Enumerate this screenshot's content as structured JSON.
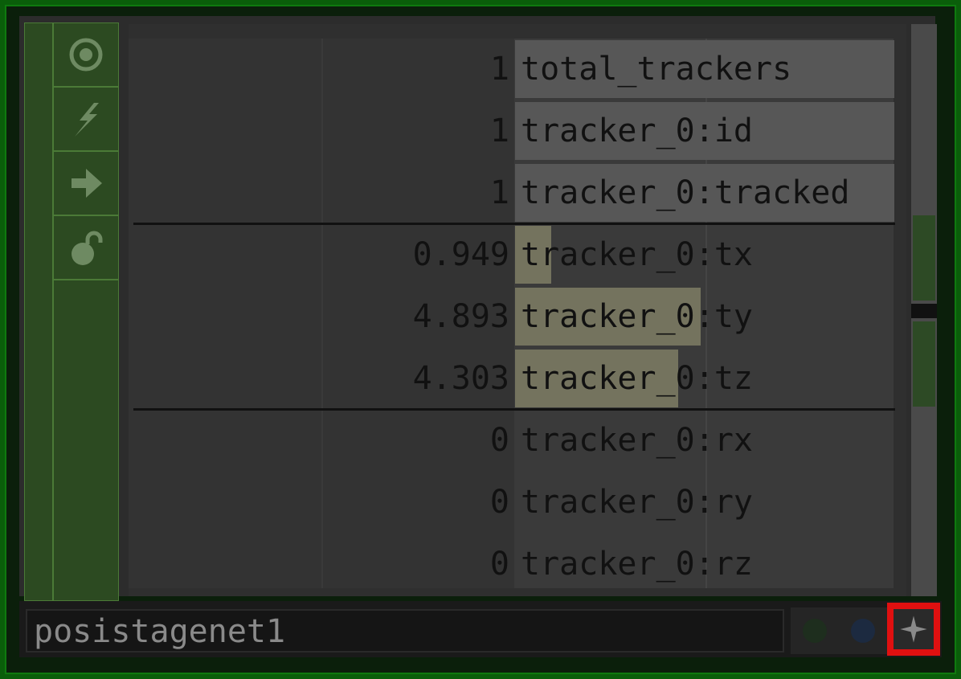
{
  "operator": {
    "name": "posistagenet1"
  },
  "toolbar": {
    "icons": [
      "viewer-active-icon",
      "bypass-icon",
      "display-icon",
      "lock-icon"
    ]
  },
  "channels": [
    {
      "value": "1",
      "name": "total_trackers",
      "fill": 1.0,
      "group": 1
    },
    {
      "value": "1",
      "name": "tracker_0:id",
      "fill": 1.0,
      "group": 1
    },
    {
      "value": "1",
      "name": "tracker_0:tracked",
      "fill": 1.0,
      "group": 1
    },
    {
      "value": "0.949",
      "name": "tracker_0:tx",
      "fill": 0.19,
      "group": 2
    },
    {
      "value": "4.893",
      "name": "tracker_0:ty",
      "fill": 0.98,
      "group": 2
    },
    {
      "value": "4.303",
      "name": "tracker_0:tz",
      "fill": 0.86,
      "group": 2
    },
    {
      "value": "0",
      "name": "tracker_0:rx",
      "fill": 0.0,
      "group": 3
    },
    {
      "value": "0",
      "name": "tracker_0:ry",
      "fill": 0.0,
      "group": 3
    },
    {
      "value": "0",
      "name": "tracker_0:rz",
      "fill": 0.0,
      "group": 3
    }
  ],
  "footer": {
    "buttons": [
      "green-flag-icon",
      "blue-flag-icon",
      "add-icon"
    ]
  },
  "colors": {
    "border": "#0f7a0f",
    "toolbar": "#2c4a21",
    "bar": "#74735e",
    "highlight": "#e01010"
  }
}
